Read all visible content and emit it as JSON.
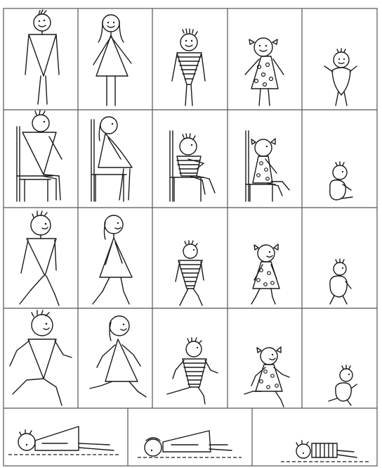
{
  "worksheet": {
    "columns": [
      "man",
      "woman",
      "boy",
      "girl",
      "baby"
    ],
    "rows": [
      "standing",
      "sitting",
      "walking",
      "running"
    ],
    "lying_figures": [
      "man",
      "woman",
      "boy"
    ],
    "colors": {
      "ink": "#1a1a1a",
      "grid": "#555555",
      "paper": "#ffffff"
    }
  }
}
